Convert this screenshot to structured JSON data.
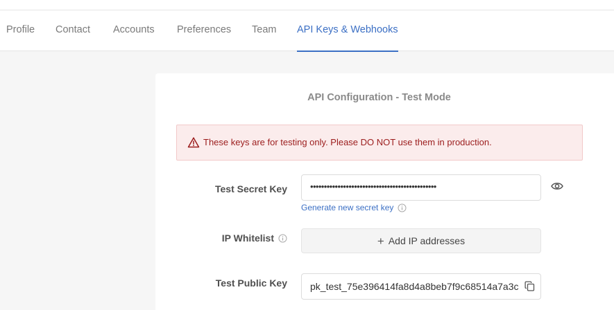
{
  "tabs": [
    {
      "label": "Profile"
    },
    {
      "label": "Contact"
    },
    {
      "label": "Accounts"
    },
    {
      "label": "Preferences"
    },
    {
      "label": "Team"
    },
    {
      "label": "API Keys & Webhooks",
      "active": true
    }
  ],
  "card": {
    "title": "API Configuration - Test Mode",
    "alert": {
      "icon": "warning-triangle-icon",
      "text": "These keys are for testing only. Please DO NOT use them in production."
    },
    "secret_key": {
      "label": "Test Secret Key",
      "value": "••••••••••••••••••••••••••••••••••••••••••••••",
      "reveal_icon": "eye-icon",
      "generate_link": "Generate new secret key"
    },
    "ip_whitelist": {
      "label": "IP Whitelist",
      "button_label": "Add IP addresses"
    },
    "public_key": {
      "label": "Test Public Key",
      "value": "pk_test_75e396414fa8d4a8beb7f9c68514a7a3c",
      "copy_icon": "copy-icon"
    }
  },
  "colors": {
    "accent": "#3b6fc4",
    "alert_bg": "#fbecec",
    "alert_text": "#9b1c1c"
  }
}
